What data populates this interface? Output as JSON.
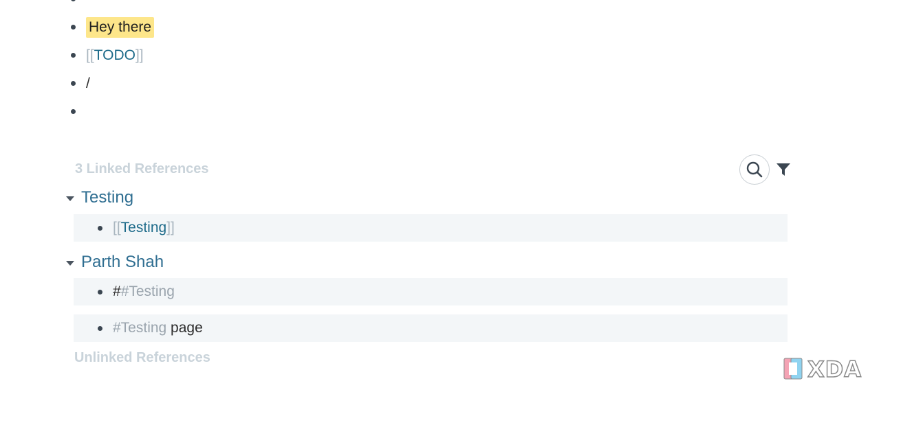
{
  "bullets": {
    "item1": "",
    "item2": "Hey there",
    "item3": {
      "open": "[[",
      "link": "TODO",
      "close": "]]"
    },
    "item4": "/",
    "item5": ""
  },
  "references": {
    "linked_header": "3 Linked References",
    "search_icon": "search-icon",
    "filter_icon": "filter-icon",
    "groups": [
      {
        "title": "Testing",
        "blocks": [
          {
            "open": "[[",
            "link": "Testing",
            "close": "]]"
          }
        ]
      },
      {
        "title": "Parth Shah",
        "blocks": [
          {
            "prefix": "#",
            "tag": "#Testing"
          },
          {
            "tag": "#Testing",
            "suffix": " page"
          }
        ]
      }
    ],
    "unlinked_header": "Unlinked References"
  },
  "watermark": {
    "text": "XDA",
    "colors": {
      "pink": "#f4a3b4",
      "blue": "#8fd3f0"
    }
  },
  "colors": {
    "link": "#1e6b8a",
    "highlight": "#fde68a",
    "block_bg": "#f3f6f8",
    "muted_header": "#c9d3da"
  }
}
